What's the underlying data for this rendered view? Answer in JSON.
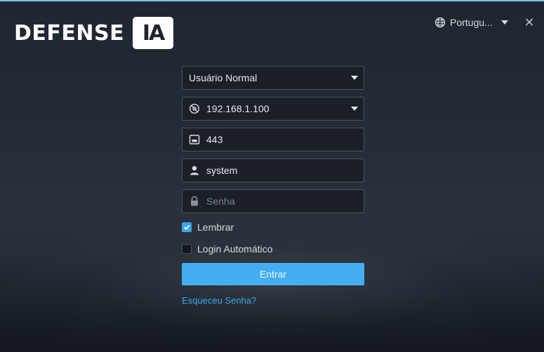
{
  "brand": {
    "name": "DEFENSE",
    "badge": "IA"
  },
  "header": {
    "language": "Portugu...",
    "language_icon": "globe-icon",
    "close_glyph": "✕"
  },
  "form": {
    "user_type": {
      "value": "Usuário Normal",
      "options": [
        "Usuário Normal"
      ]
    },
    "server": {
      "icon": "network-icon",
      "value": "192.168.1.100"
    },
    "port": {
      "icon": "port-icon",
      "value": "443"
    },
    "username": {
      "icon": "user-icon",
      "value": "system"
    },
    "password": {
      "icon": "lock-icon",
      "value": "",
      "placeholder": "Senha"
    },
    "remember": {
      "label": "Lembrar",
      "checked": true
    },
    "auto_login": {
      "label": "Login Automático",
      "checked": false
    },
    "submit_label": "Entrar",
    "forgot_label": "Esqueceu Senha?"
  },
  "colors": {
    "accent": "#45aef2",
    "link": "#3ba6ea",
    "background": "#242b35"
  }
}
